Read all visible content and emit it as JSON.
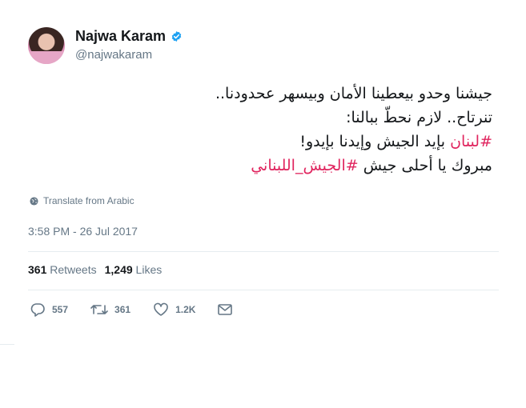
{
  "user": {
    "name": "Najwa Karam",
    "handle": "@najwakaram",
    "verified": true,
    "verified_color": "#1da1f2"
  },
  "tweet": {
    "line1": "جيشنا وحدو بيعطينا الأمان وبيسهر عحدودنا..",
    "line2": "تنرتاح.. لازم نحطّ ببالنا:",
    "line3_hashtag": "#لبنان",
    "line3_text": " بإيد الجيش وإيدنا بإيدو!",
    "line4_text": "مبروك يا أحلى جيش ",
    "line4_hashtag": "#الجيش_اللبناني",
    "hashtag_color": "#e0245e"
  },
  "translate_label": "Translate from Arabic",
  "timestamp": "3:58 PM - 26 Jul 2017",
  "stats": {
    "retweets_count": "361",
    "retweets_label": "Retweets",
    "likes_count": "1,249",
    "likes_label": "Likes"
  },
  "actions": {
    "reply_count": "557",
    "retweet_count": "361",
    "like_count": "1.2K"
  },
  "icons": {
    "reply": "reply-icon",
    "retweet": "retweet-icon",
    "like": "heart-icon",
    "message": "envelope-icon",
    "globe": "globe-icon",
    "verified": "verified-badge-icon"
  }
}
